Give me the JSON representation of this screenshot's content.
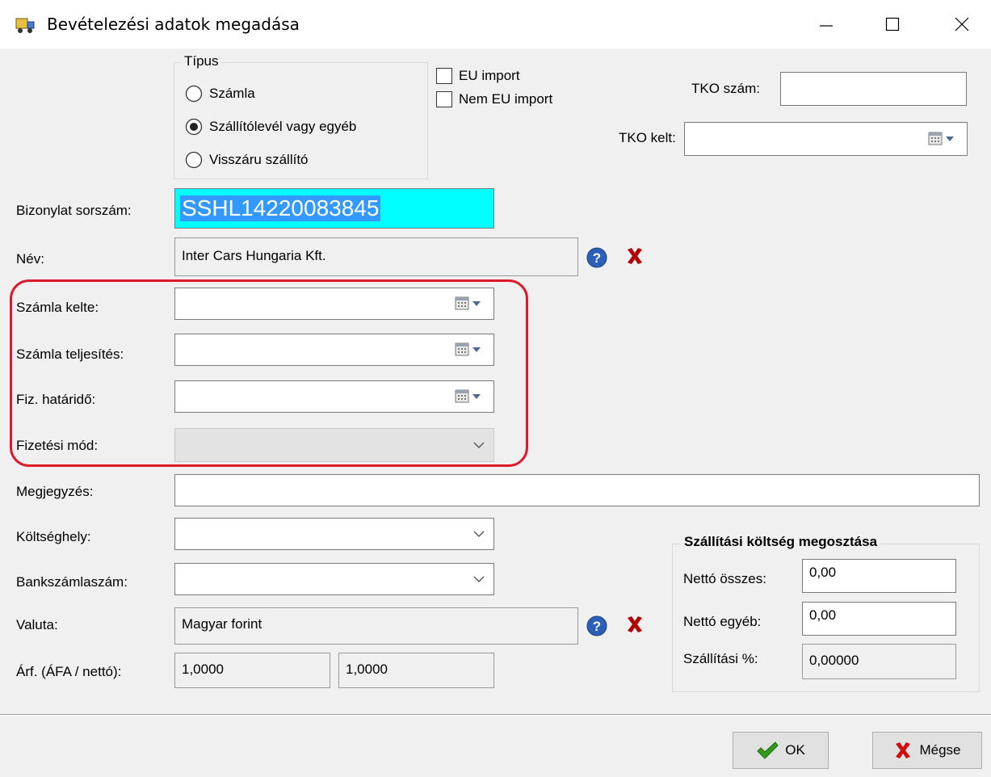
{
  "window": {
    "title": "Bevételezési adatok megadása",
    "controls": {
      "minimize": "—",
      "maximize": "☐",
      "close": "✕"
    }
  },
  "tipus": {
    "legend": "Típus",
    "options": [
      "Számla",
      "Szállítólevél vagy egyéb",
      "Visszáru szállító"
    ],
    "selected": "Szállítólevél vagy egyéb"
  },
  "import": {
    "eu_label": "EU import",
    "eu_checked": false,
    "non_eu_label": "Nem EU import",
    "non_eu_checked": false
  },
  "tko": {
    "szam_label": "TKO szám:",
    "szam_value": "",
    "kelt_label": "TKO kelt:",
    "kelt_value": ""
  },
  "form": {
    "bizonylat": {
      "label": "Bizonylat sorszám:",
      "value": "SSHL14220083845"
    },
    "nev": {
      "label": "Név:",
      "value": "Inter Cars Hungaria Kft."
    },
    "szamla_kelte": {
      "label": "Számla kelte:",
      "value": ""
    },
    "szamla_teljesites": {
      "label": "Számla teljesítés:",
      "value": ""
    },
    "fiz_hatarido": {
      "label": "Fiz. határidő:",
      "value": ""
    },
    "fizetesi_mod": {
      "label": "Fizetési mód:",
      "value": ""
    },
    "megjegyzes": {
      "label": "Megjegyzés:",
      "value": ""
    },
    "koltseghely": {
      "label": "Költséghely:",
      "value": ""
    },
    "bankszamla": {
      "label": "Bankszámlaszám:",
      "value": ""
    },
    "valuta": {
      "label": "Valuta:",
      "value": "Magyar forint"
    },
    "arfolyam": {
      "label": "Árf. (ÁFA / nettó):",
      "afa": "1,0000",
      "netto": "1,0000"
    }
  },
  "szallitasi": {
    "legend": "Szállítási költség megosztása",
    "netto_osszes_label": "Nettó összes:",
    "netto_osszes": "0,00",
    "netto_egyeb_label": "Nettó egyéb:",
    "netto_egyeb": "0,00",
    "szazalek_label": "Szállítási %:",
    "szazalek": "0,00000"
  },
  "buttons": {
    "ok": "OK",
    "cancel": "Mégse"
  },
  "colors": {
    "highlight": "#e0182c",
    "selection_bg": "#00ffff",
    "selection_text_bg": "#3399ff"
  },
  "icons": [
    "app-truck-icon",
    "calendar-icon",
    "chevron-down-icon",
    "help-icon",
    "delete-x-icon",
    "checkmark-icon"
  ]
}
